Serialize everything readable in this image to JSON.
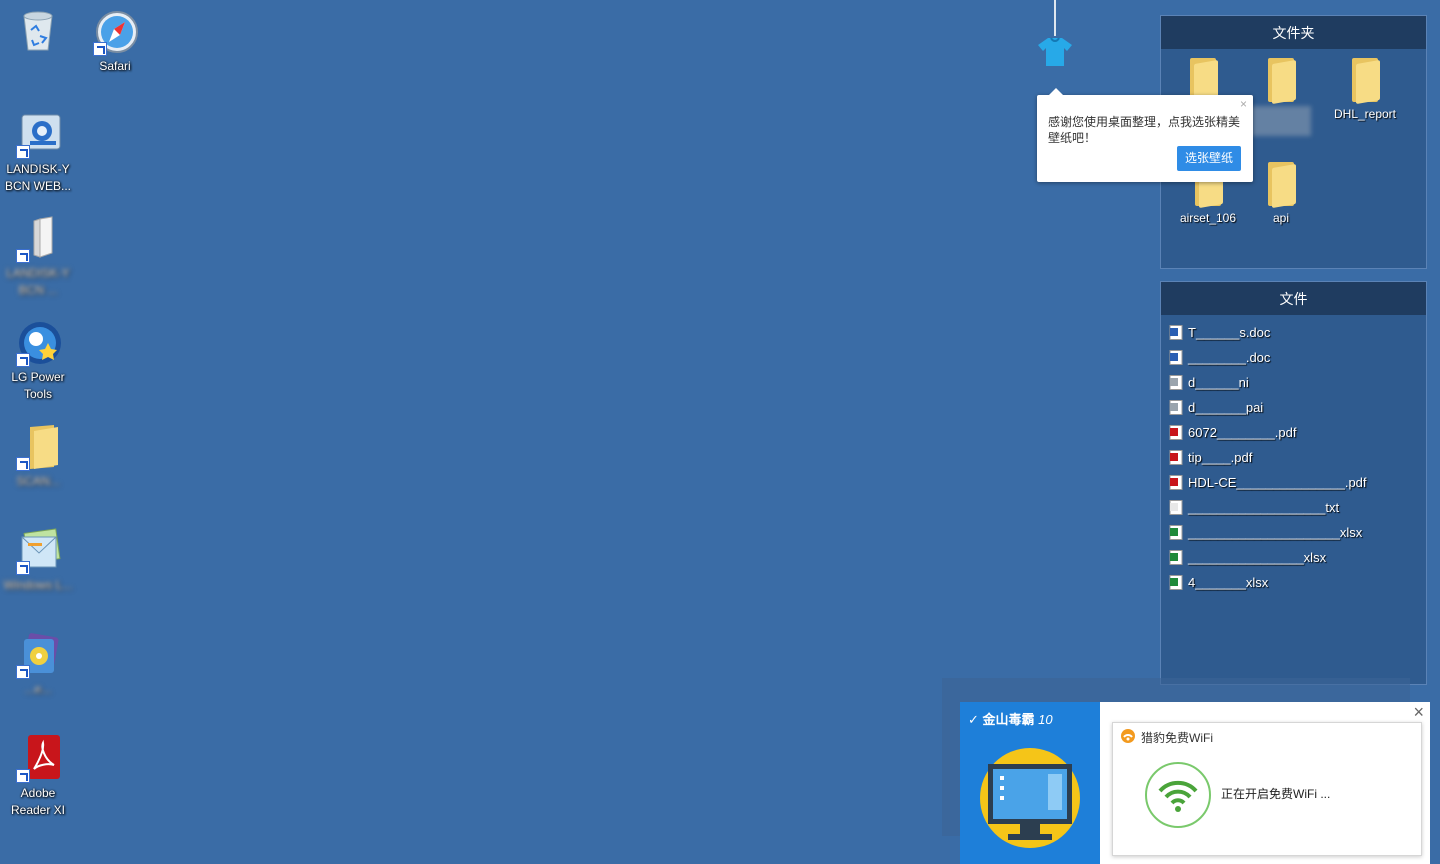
{
  "desktop": {
    "icons": [
      {
        "label": ""
      },
      {
        "label": "Safari"
      },
      {
        "label": "LANDISK-Y BCN WEB..."
      },
      {
        "label": "LANDISK-Y BCN ..."
      },
      {
        "label": "LG Power Tools"
      },
      {
        "label": "SCAN..."
      },
      {
        "label": "Windows L..."
      },
      {
        "label": "...e..."
      },
      {
        "label": "Adobe Reader XI"
      }
    ]
  },
  "folder_fence": {
    "title": "文件夹",
    "items": [
      "",
      "",
      "DHL_report",
      "airset_106",
      "api"
    ]
  },
  "file_fence": {
    "title": "文件",
    "files": [
      {
        "name": "T______s.doc",
        "type": "word"
      },
      {
        "name": "________.doc",
        "type": "word"
      },
      {
        "name": "d______ni",
        "type": "gear"
      },
      {
        "name": "d_______pai",
        "type": "gear"
      },
      {
        "name": "6072________.pdf",
        "type": "pdf"
      },
      {
        "name": "tip____.pdf",
        "type": "pdf"
      },
      {
        "name": "HDL-CE_______________.pdf",
        "type": "pdf"
      },
      {
        "name": "___________________txt",
        "type": "txt"
      },
      {
        "name": "_____________________xlsx",
        "type": "xlsx"
      },
      {
        "name": "________________xlsx",
        "type": "xlsx"
      },
      {
        "name": "4_______xlsx",
        "type": "xlsx"
      }
    ]
  },
  "wallpaper_tip": {
    "text": "感谢您使用桌面整理，点我选张精美壁纸吧！",
    "button": "选张壁纸",
    "close": "×"
  },
  "kingsoft_popup": {
    "brand": "金山毒霸",
    "version": "10",
    "close": "×"
  },
  "wifi_popup": {
    "title": "猎豹免费WiFi",
    "status": "正在开启免费WiFi ..."
  },
  "colors": {
    "desktop_bg": "#3a6ca6",
    "fence_header": "#1f3c60",
    "accent_blue": "#2f8ce6",
    "kingsoft_blue": "#1e7fd9",
    "wifi_green": "#4aa43a"
  }
}
